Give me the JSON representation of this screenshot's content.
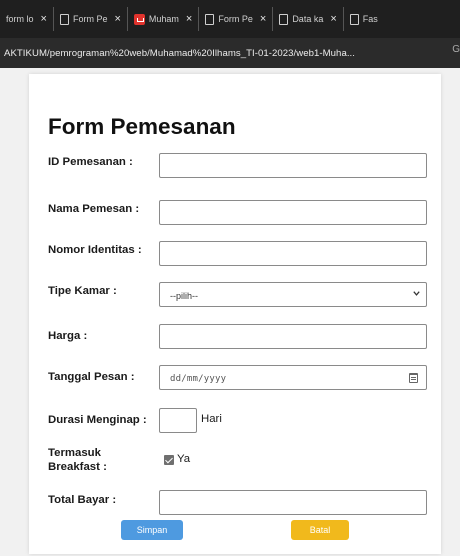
{
  "browser": {
    "tabs": [
      {
        "label": "form lo",
        "icon": "page-icon",
        "close": "×"
      },
      {
        "label": "Form Pe",
        "icon": "page-icon",
        "close": "×"
      },
      {
        "label": "Muham",
        "icon": "pdf-icon",
        "close": "×"
      },
      {
        "label": "Form Pe",
        "icon": "page-icon",
        "close": "×"
      },
      {
        "label": "Data ka",
        "icon": "page-icon",
        "close": "×"
      },
      {
        "label": "Fas",
        "icon": "page-icon",
        "close": ""
      }
    ],
    "url": "AKTIKUM/pemrograman%20web/Muhamad%20Ilhams_TI-01-2023/web1-Muha...",
    "address_right": "G"
  },
  "form": {
    "title": "Form Pemesanan",
    "fields": {
      "id": {
        "label": "ID Pemesanan :",
        "value": ""
      },
      "name": {
        "label": "Nama Pemesan :",
        "value": ""
      },
      "identity": {
        "label": "Nomor Identitas :",
        "value": ""
      },
      "room_type": {
        "label": "Tipe Kamar :",
        "selected": "--pilih--"
      },
      "price": {
        "label": "Harga :",
        "value": ""
      },
      "order_date": {
        "label": "Tanggal Pesan :",
        "placeholder": "dd/mm/yyyy"
      },
      "duration": {
        "label": "Durasi Menginap :",
        "value": "",
        "unit": "Hari"
      },
      "breakfast": {
        "label_line1": "Termasuk",
        "label_line2": "Breakfast :",
        "option": "Ya",
        "checked": true
      },
      "total": {
        "label": "Total Bayar :",
        "value": ""
      }
    },
    "buttons": {
      "save": "Simpan",
      "cancel": "Batal"
    },
    "colors": {
      "save": "#4e9ae0",
      "cancel": "#f1b91c"
    }
  }
}
